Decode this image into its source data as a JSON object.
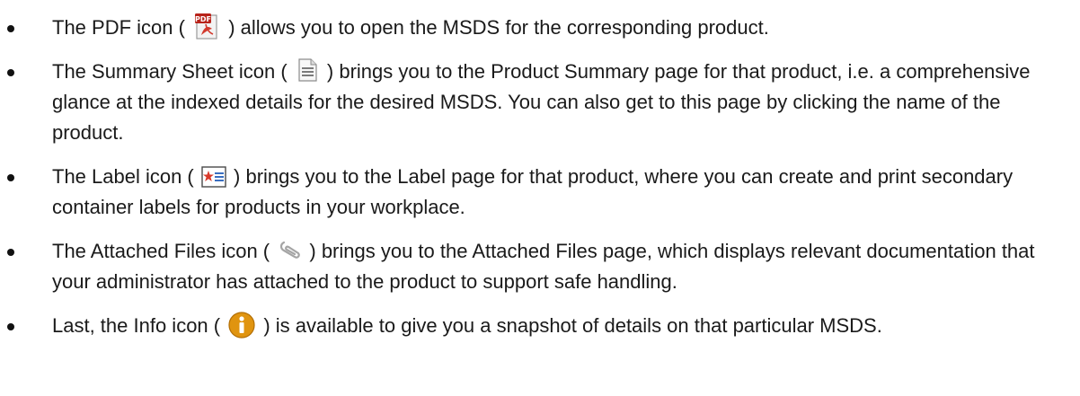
{
  "bullets": [
    {
      "before": "The PDF icon (",
      "icon": "pdf-icon",
      "after": ") allows you to open the MSDS for the corresponding product."
    },
    {
      "before": "The Summary Sheet icon (",
      "icon": "summary-sheet-icon",
      "after": ") brings you to the Product Summary page for that product, i.e. a comprehensive glance at the indexed details for the desired MSDS. You can also get to this page by clicking the name of the product."
    },
    {
      "before": "The Label icon (",
      "icon": "label-icon",
      "after": ") brings you to the Label page for that product, where you can create and print secondary container labels for products in your workplace."
    },
    {
      "before": "The Attached Files icon (",
      "icon": "paperclip-icon",
      "after": ") brings you to the Attached Files page, which displays relevant documentation that your administrator has attached to the product to support safe handling."
    },
    {
      "before": "Last, the Info icon (",
      "icon": "info-icon",
      "after": ") is available to give you a snapshot of details on that particular MSDS."
    }
  ],
  "colors": {
    "pdf_red": "#c0392b",
    "info_amber": "#d88a0c",
    "label_blue": "#3b6fc0"
  }
}
